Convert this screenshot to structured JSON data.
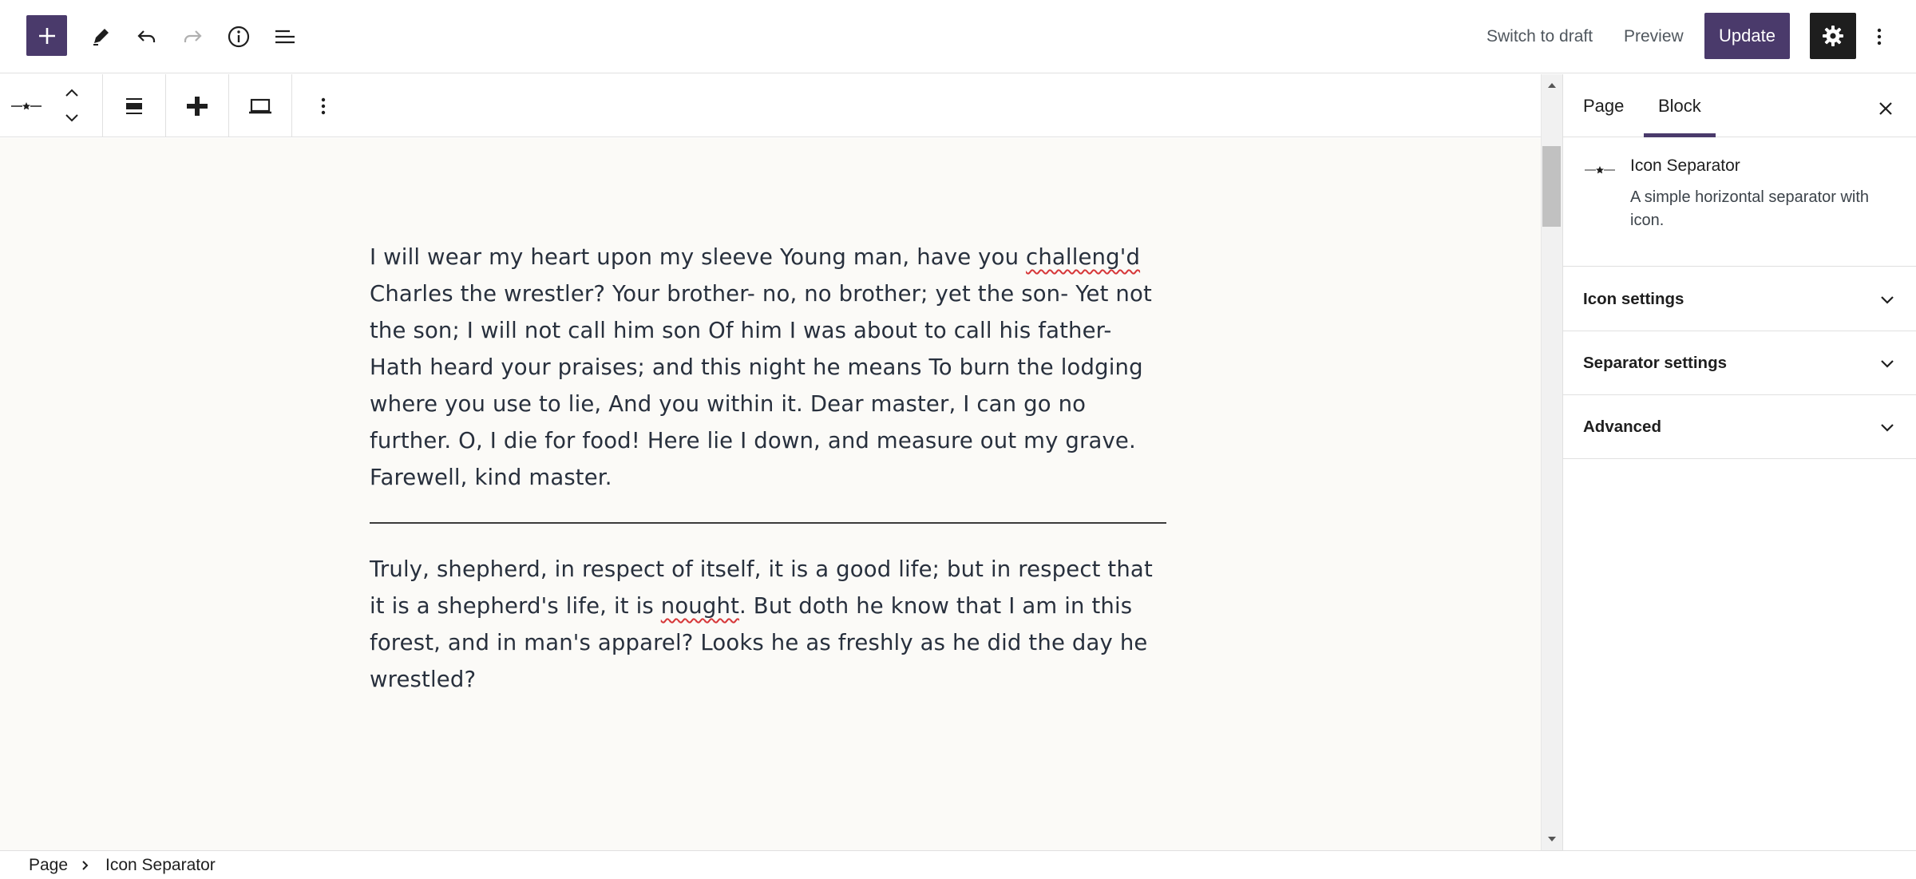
{
  "header": {
    "inserter_icon": "plus-icon",
    "tools_icon": "pencil-icon",
    "undo_icon": "undo-icon",
    "redo_icon": "redo-icon",
    "info_icon": "info-icon",
    "list_view_icon": "list-view-icon",
    "switch_to_draft": "Switch to draft",
    "preview": "Preview",
    "update": "Update",
    "settings_icon": "gear-icon",
    "options_icon": "more-vertical-icon"
  },
  "block_toolbar": {
    "block_icon": "icon-separator-icon",
    "move_icons": [
      "chevron-up-icon",
      "chevron-down-icon"
    ],
    "align_icon": "align-icon",
    "style_icon": "separator-style-icon",
    "width_icon": "laptop-icon",
    "more_icon": "more-vertical-icon"
  },
  "canvas": {
    "paragraph_1": {
      "before": "I will wear my heart upon my sleeve Young man, have you ",
      "misspelled": "challeng'd",
      "after": " Charles the wrestler? Your brother- no, no brother; yet the son- Yet not the son; I will not call him son Of him I was about to call his father- Hath heard your praises; and this night he means To burn the lodging where you use to lie, And you within it. Dear master, I can go no further. O, I die for food! Here lie I down, and measure out my grave. Farewell, kind master."
    },
    "paragraph_2": {
      "before": "Truly, shepherd, in respect of itself, it is a good life; but in respect that it is a shepherd's life, it is ",
      "misspelled": "nought",
      "after": ". But doth he know that I am in this forest, and in man's apparel? Looks he as freshly as he did the day he wrestled?"
    }
  },
  "sidebar": {
    "tabs": [
      {
        "label": "Page",
        "active": false
      },
      {
        "label": "Block",
        "active": true
      }
    ],
    "close_icon": "close-icon",
    "block_card": {
      "title": "Icon Separator",
      "description": "A simple horizontal separator with icon."
    },
    "panels": [
      {
        "label": "Icon settings",
        "expanded": false
      },
      {
        "label": "Separator settings",
        "expanded": false
      },
      {
        "label": "Advanced",
        "expanded": false
      }
    ]
  },
  "breadcrumb": {
    "items": [
      "Page",
      "Icon Separator"
    ]
  },
  "colors": {
    "accent": "#4a3a6b",
    "canvas_bg": "#fbfaf7",
    "text": "#28303d",
    "spellcheck": "#d63638"
  }
}
